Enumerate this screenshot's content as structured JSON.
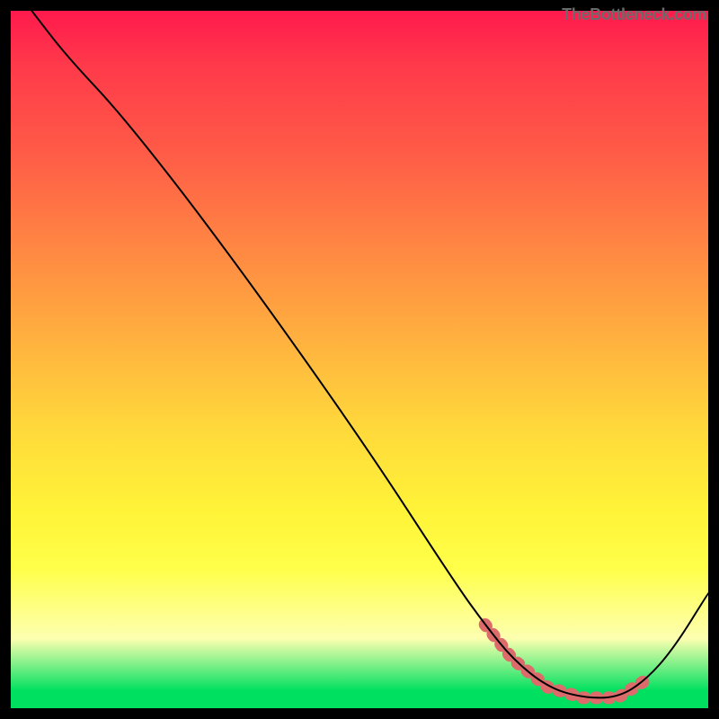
{
  "watermark": "TheBottleneck.com",
  "chart_data": {
    "type": "line",
    "title": "",
    "xlabel": "",
    "ylabel": "",
    "xlim": [
      0,
      1
    ],
    "ylim": [
      0,
      1
    ],
    "grid": false,
    "legend": false,
    "background_gradient": {
      "stops": [
        {
          "pos": 0.0,
          "color": "#ff1a4d"
        },
        {
          "pos": 0.5,
          "color": "#ffba3e"
        },
        {
          "pos": 0.8,
          "color": "#ffff4a"
        },
        {
          "pos": 0.97,
          "color": "#00e060"
        },
        {
          "pos": 1.0,
          "color": "#00e060"
        }
      ]
    },
    "series": [
      {
        "name": "main-curve",
        "color": "#000000",
        "width": 2,
        "x": [
          0.03,
          0.08,
          0.16,
          0.3,
          0.5,
          0.64,
          0.68,
          0.72,
          0.77,
          0.82,
          0.87,
          0.91,
          0.95,
          1.0
        ],
        "y": [
          1.0,
          0.935,
          0.85,
          0.67,
          0.39,
          0.175,
          0.12,
          0.07,
          0.03,
          0.015,
          0.015,
          0.04,
          0.085,
          0.165
        ]
      },
      {
        "name": "highlight-band",
        "color": "#dd6b6b",
        "width": 14,
        "dash": true,
        "x": [
          0.68,
          0.72,
          0.77,
          0.82,
          0.87,
          0.91
        ],
        "y": [
          0.12,
          0.07,
          0.03,
          0.015,
          0.015,
          0.04
        ]
      }
    ]
  }
}
